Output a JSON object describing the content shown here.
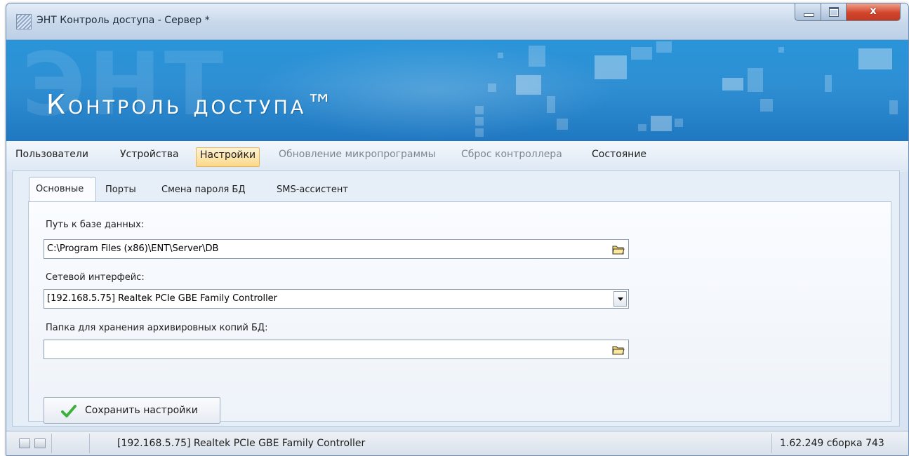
{
  "window": {
    "title": "ЭНТ Контроль доступа - Сервер *",
    "close_glyph": "x",
    "icons": [
      "app-icon",
      "minimize-icon",
      "maximize-icon",
      "close-icon"
    ]
  },
  "banner": {
    "ghost_text": "ЭНТ",
    "title": "Контроль доступа™"
  },
  "menu": {
    "items": [
      {
        "label": "Пользователи",
        "state": "enabled"
      },
      {
        "label": "Устройства",
        "state": "enabled"
      },
      {
        "label": "Настройки",
        "state": "active"
      },
      {
        "label": "Обновление микропрограммы",
        "state": "disabled"
      },
      {
        "label": "Сброс контроллера",
        "state": "disabled"
      },
      {
        "label": "Состояние",
        "state": "enabled"
      }
    ]
  },
  "tabs": [
    {
      "label": "Основные",
      "active": true
    },
    {
      "label": "Порты",
      "active": false
    },
    {
      "label": "Смена пароля БД",
      "active": false
    },
    {
      "label": "SMS-ассистент",
      "active": false
    }
  ],
  "form": {
    "db_path": {
      "label": "Путь к базе данных:",
      "value": "C:\\Program Files (x86)\\ENT\\Server\\DB"
    },
    "net_interface": {
      "label": "Сетевой интерфейс:",
      "value": "[192.168.5.75] Realtek PCIe GBE Family Controller"
    },
    "backup_folder": {
      "label": "Папка для хранения архивировных копий БД:",
      "value": ""
    },
    "save_button": "Сохранить настройки"
  },
  "status": {
    "interface": "[192.168.5.75] Realtek PCIe GBE Family Controller",
    "version": "1.62.249 сборка 743"
  },
  "colors": {
    "banner": "#2f8fd3",
    "active_menu": "#fbd989",
    "close_button": "#d1452b",
    "check_icon": "#3bb13b"
  }
}
